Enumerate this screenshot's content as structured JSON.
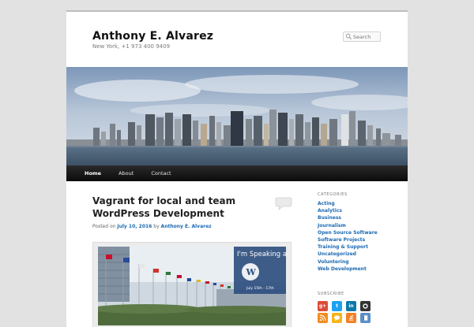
{
  "site": {
    "title": "Anthony E. Alvarez",
    "description": "New York, +1 973 400 9409"
  },
  "search": {
    "placeholder": "Search"
  },
  "nav": {
    "items": [
      "Home",
      "About",
      "Contact"
    ],
    "active": "Home"
  },
  "post": {
    "title": "Vagrant for local and team WordPress Development",
    "meta_prefix": "Posted on",
    "date": "July 10, 2016",
    "meta_by": "by",
    "author": "Anthony E. Alvarez"
  },
  "featured_image": {
    "headline": "I'm Speaking at",
    "dates": "July 15th - 17th"
  },
  "sidebar": {
    "categories_title": "CATEGORIES",
    "categories": [
      "Acting",
      "Analytics",
      "Business",
      "Journalism",
      "Open Source Software",
      "Software Projects",
      "Training & Support",
      "Uncategorized",
      "Voluntering",
      "Web Development"
    ],
    "subscribe_title": "SUBSCRIBE",
    "social": [
      {
        "icon": "google-plus-icon",
        "label": "g+",
        "color": "#dd4b39"
      },
      {
        "icon": "twitter-icon",
        "label": "t",
        "color": "#1da1f2"
      },
      {
        "icon": "linkedin-icon",
        "label": "in",
        "color": "#0e76a8"
      },
      {
        "icon": "github-icon",
        "label": "",
        "color": "#333333"
      },
      {
        "icon": "rss-icon",
        "label": "",
        "color": "#f28c1e"
      },
      {
        "icon": "chat-bubble-icon",
        "label": "",
        "color": "#f6b419"
      },
      {
        "icon": "stack-overflow-icon",
        "label": "",
        "color": "#f48024"
      },
      {
        "icon": "book-icon",
        "label": "",
        "color": "#5b8fc7"
      }
    ]
  },
  "colors": {
    "link": "#1b6ab3",
    "nav_bg": "#111111",
    "page_bg": "#e2e2e2"
  }
}
